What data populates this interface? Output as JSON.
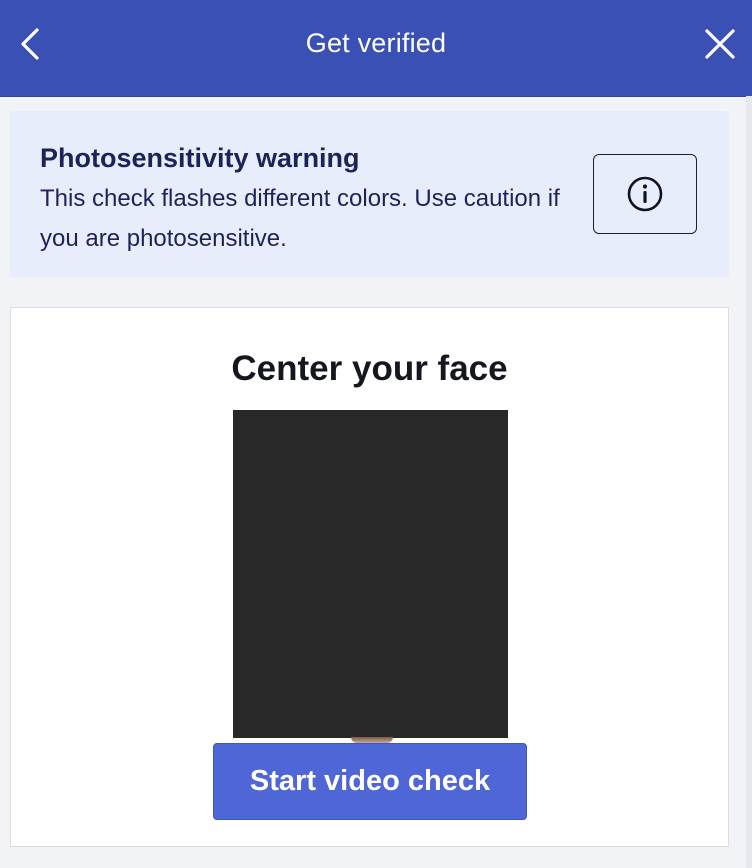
{
  "header": {
    "title": "Get verified",
    "back_icon": "chevron-left-icon",
    "close_icon": "close-icon",
    "background_color": "#3a50b4"
  },
  "warning": {
    "title": "Photosensitivity warning",
    "body": "This check flashes different colors. Use caution if you are photosensitive.",
    "info_icon": "info-icon",
    "background_color": "#e8edfc"
  },
  "face_check": {
    "title": "Center your face",
    "start_label": "Start video check",
    "button_color": "#4f66d6"
  }
}
